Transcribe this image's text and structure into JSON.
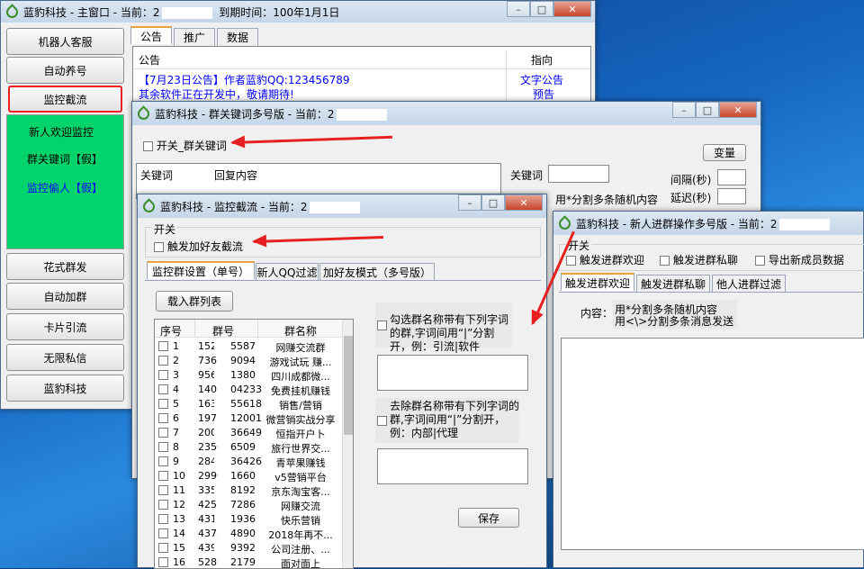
{
  "main_window": {
    "title_prefix": "蓝豹科技 - 主窗口 - 当前：2",
    "title_suffix": "到期时间：100年1月1日",
    "nav": [
      "机器人客服",
      "自动养号",
      "监控截流"
    ],
    "sub_nav": [
      "新人欢迎监控",
      "群关键词【假】",
      "监控偷人【假】"
    ],
    "nav2": [
      "花式群发",
      "自动加群",
      "卡片引流",
      "无限私信",
      "蓝豹科技"
    ],
    "tabs": [
      "公告",
      "推广",
      "数据"
    ],
    "table_headers": [
      "公告",
      "指向"
    ],
    "rows": [
      {
        "text": "【7月23日公告】作者蓝豹QQ:123456789",
        "target": "文字公告"
      },
      {
        "text": "其余软件正在开发中，敬请期待!",
        "target": "预告"
      }
    ]
  },
  "kw_window": {
    "title": "蓝豹科技 - 群关键词多号版 - 当前：2",
    "switch_label": "开关_群关键词",
    "var_button": "变量",
    "col_keyword": "关键词",
    "col_reply": "回复内容",
    "kw_label": "关键词",
    "interval_label": "间隔(秒)",
    "delay_label": "延迟(秒)",
    "hint": "用*分割多条随机内容",
    "hint2": "用<\\>分割多条消息发送"
  },
  "monitor_window": {
    "title": "蓝豹科技 - 监控截流 - 当前：2",
    "group_label": "开关",
    "trigger_label": "触发加好友截流",
    "tabs": [
      "监控群设置（单号）",
      "新人QQ过滤",
      "加好友模式（多号版）"
    ],
    "load_button": "载入群列表",
    "col_headers": [
      "序号",
      "群号",
      "群名称"
    ],
    "rows": [
      {
        "n": "1",
        "id": "152",
        "id2": "5587",
        "name": "网赚交流群"
      },
      {
        "n": "2",
        "id": "736",
        "id2": "9094",
        "name": "游戏试玩 赚..."
      },
      {
        "n": "3",
        "id": "956",
        "id2": "1380",
        "name": "四川成都微..."
      },
      {
        "n": "4",
        "id": "140",
        "id2": "04233",
        "name": "免费挂机赚钱"
      },
      {
        "n": "5",
        "id": "163",
        "id2": "55618",
        "name": "销售/营销"
      },
      {
        "n": "6",
        "id": "197",
        "id2": "12001",
        "name": "微营销实战分享"
      },
      {
        "n": "7",
        "id": "2006",
        "id2": "36649",
        "name": "恒指开户卜"
      },
      {
        "n": "8",
        "id": "2350",
        "id2": "6509",
        "name": "旅行世界交..."
      },
      {
        "n": "9",
        "id": "2842",
        "id2": "36426",
        "name": "青苹果赚钱"
      },
      {
        "n": "10",
        "id": "2996",
        "id2": "1660",
        "name": "v5营销平台"
      },
      {
        "n": "11",
        "id": "3353",
        "id2": "8192",
        "name": "京东淘宝客..."
      },
      {
        "n": "12",
        "id": "4257",
        "id2": "7286",
        "name": "网赚交流"
      },
      {
        "n": "13",
        "id": "4312",
        "id2": "1936",
        "name": "快乐营销"
      },
      {
        "n": "14",
        "id": "4373",
        "id2": "4890",
        "name": "2018年再不..."
      },
      {
        "n": "15",
        "id": "4390",
        "id2": "9392",
        "name": "公司注册、..."
      },
      {
        "n": "16",
        "id": "5289",
        "id2": "2179",
        "name": "面对面上"
      }
    ],
    "include_label": "勾选群名称带有下列字词的群,字词间用“|”分割开，例：引流|软件",
    "exclude_label": "去除群名称带有下列字词的群,字词间用“|”分割开，例：内部|代理",
    "save_button": "保存"
  },
  "newbie_window": {
    "title": "蓝豹科技 - 新人进群操作多号版 - 当前：2",
    "group_label": "开关",
    "checks": [
      "触发进群欢迎",
      "触发进群私聊",
      "导出新成员数据"
    ],
    "tabs": [
      "触发进群欢迎",
      "触发进群私聊",
      "他人进群过滤"
    ],
    "content_label": "内容：",
    "hint1": "用*分割多条随机内容",
    "hint2": "用<\\>分割多条消息发送"
  },
  "colors": {
    "green_panel": "#00d46a",
    "link_blue": "#0000ff",
    "arrow_red": "#e62020"
  }
}
